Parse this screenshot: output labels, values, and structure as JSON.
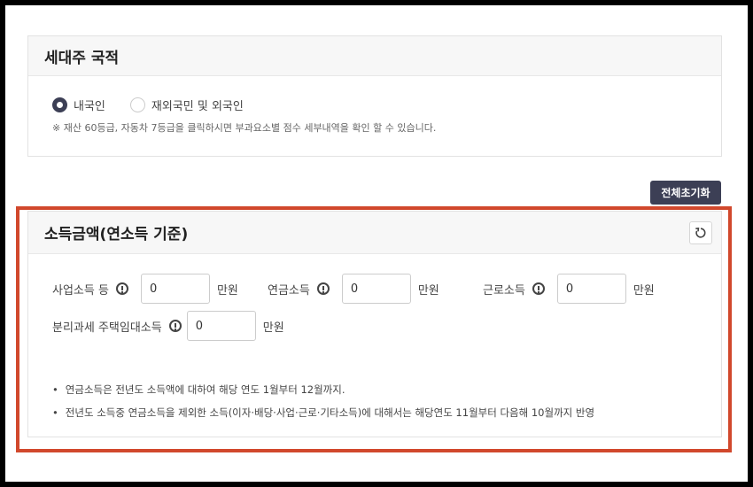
{
  "nationality": {
    "title": "세대주 국적",
    "options": [
      {
        "label": "내국인",
        "selected": true
      },
      {
        "label": "재외국민 및 외국인",
        "selected": false
      }
    ],
    "note": "※ 재산 60등급, 자동차 7등급을 클릭하시면 부과요소별 점수 세부내역을 확인 할 수 있습니다."
  },
  "reset_all_label": "전체초기화",
  "income": {
    "title": "소득금액(연소득 기준)",
    "refresh_icon": "refresh-icon",
    "fields": [
      {
        "label": "사업소득 등",
        "value": "0",
        "unit": "만원"
      },
      {
        "label": "연금소득",
        "value": "0",
        "unit": "만원"
      },
      {
        "label": "근로소득",
        "value": "0",
        "unit": "만원"
      },
      {
        "label": "분리과세 주택임대소득",
        "value": "0",
        "unit": "만원"
      }
    ],
    "notes": [
      "연금소득은 전년도 소득액에 대하여 해당 연도 1월부터 12월까지.",
      "전년도 소득중 연금소득을 제외한 소득(이자·배당·사업·근로·기타소득)에 대해서는 해당연도 11월부터 다음해 10월까지 반영"
    ]
  },
  "colors": {
    "accent": "#3c3f55",
    "highlight": "#d1482c"
  }
}
